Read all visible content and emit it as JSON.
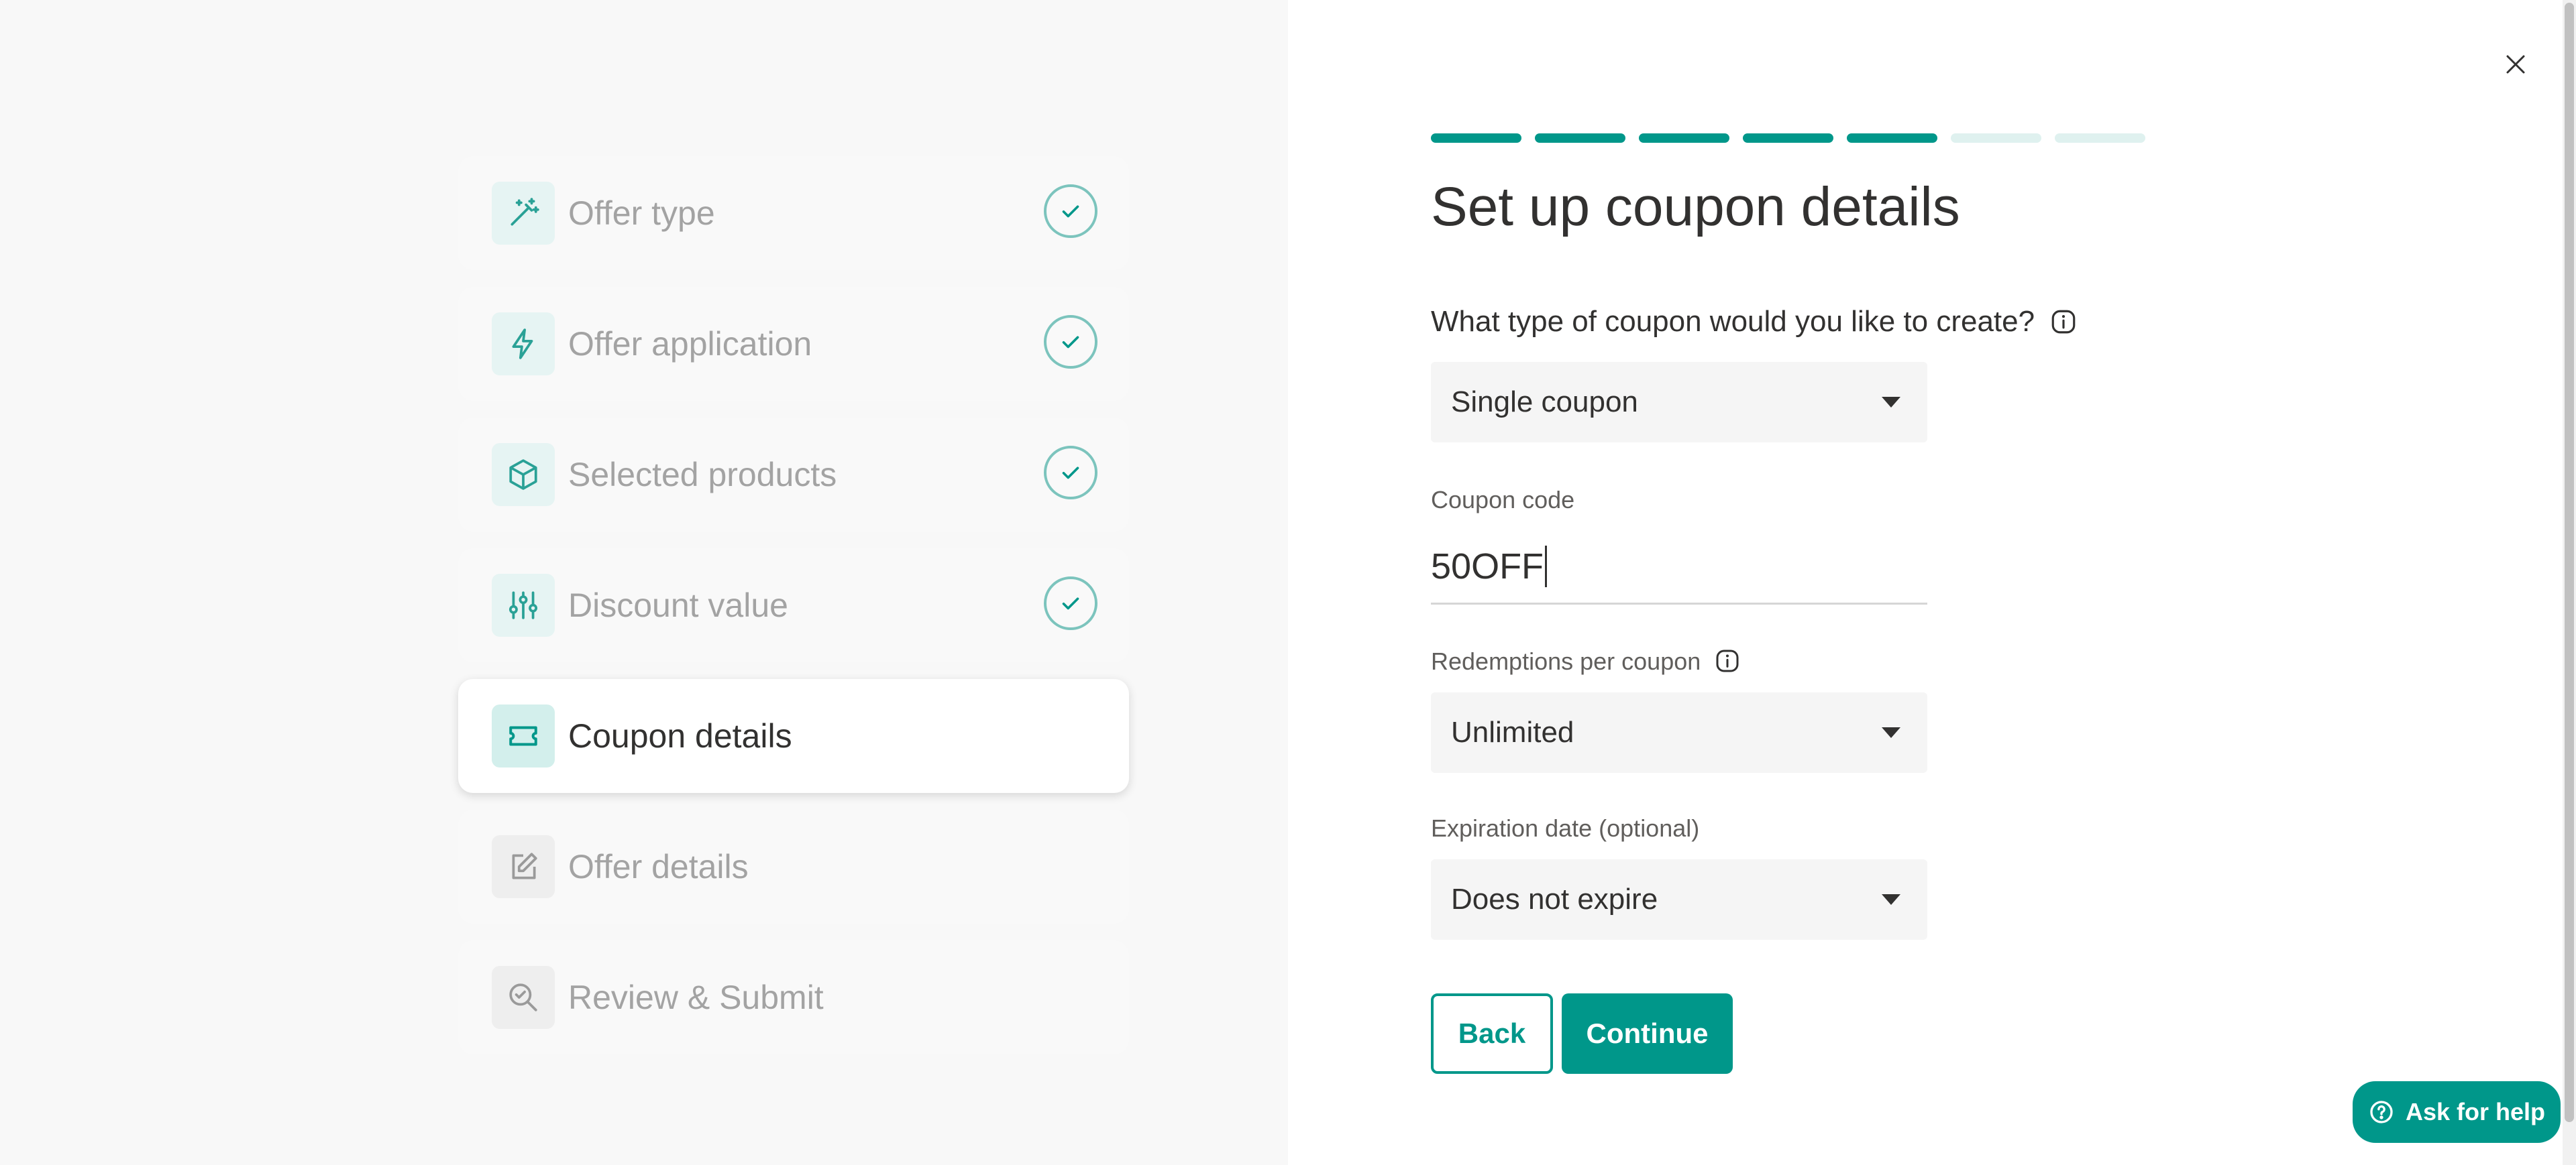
{
  "colors": {
    "accent": "#00978a",
    "accent_light": "#dff1ef",
    "check": "#7cc4bd"
  },
  "steps": [
    {
      "label": "Offer type",
      "icon": "magic-wand-icon",
      "status": "completed"
    },
    {
      "label": "Offer application",
      "icon": "lightning-icon",
      "status": "completed"
    },
    {
      "label": "Selected products",
      "icon": "box-icon",
      "status": "completed"
    },
    {
      "label": "Discount value",
      "icon": "sliders-icon",
      "status": "completed"
    },
    {
      "label": "Coupon details",
      "icon": "ticket-icon",
      "status": "active"
    },
    {
      "label": "Offer details",
      "icon": "edit-icon",
      "status": "pending"
    },
    {
      "label": "Review & Submit",
      "icon": "search-check-icon",
      "status": "pending"
    }
  ],
  "progress": {
    "completed": 5,
    "total": 7
  },
  "form": {
    "title": "Set up coupon details",
    "coupon_type_question": "What type of coupon would you like to create?",
    "coupon_type_value": "Single coupon",
    "coupon_code_label": "Coupon code",
    "coupon_code_value": "50OFF",
    "redemptions_label": "Redemptions per coupon",
    "redemptions_value": "Unlimited",
    "expiration_label": "Expiration date (optional)",
    "expiration_value": "Does not expire"
  },
  "buttons": {
    "back": "Back",
    "continue": "Continue",
    "help": "Ask for help"
  }
}
